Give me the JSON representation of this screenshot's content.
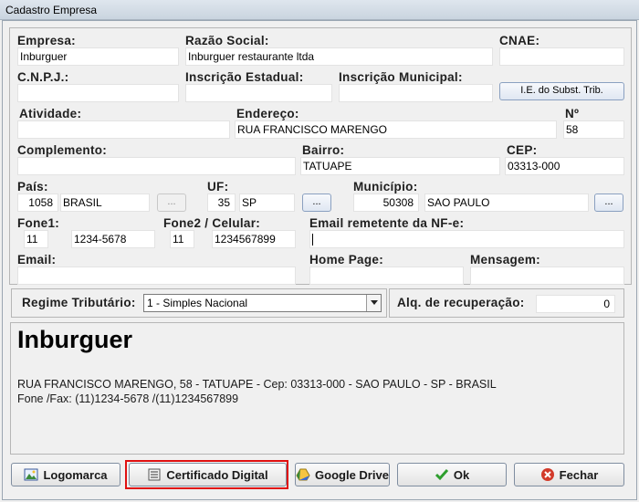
{
  "window": {
    "title": "Cadastro Empresa"
  },
  "fields": {
    "empresa": {
      "label": "Empresa:",
      "value": "Inburguer"
    },
    "razao_social": {
      "label": "Razão Social:",
      "value": "Inburguer restaurante ltda"
    },
    "cnae": {
      "label": "CNAE:",
      "value": ""
    },
    "cnpj": {
      "label": "C.N.P.J.:",
      "value": ""
    },
    "inscricao_estadual": {
      "label": "Inscrição Estadual:",
      "value": ""
    },
    "inscricao_municipal": {
      "label": "Inscrição Municipal:",
      "value": ""
    },
    "ie_subst_button": "I.E. do Subst. Trib.",
    "atividade": {
      "label": "Atividade:",
      "value": ""
    },
    "endereco": {
      "label": "Endereço:",
      "value": "RUA FRANCISCO MARENGO"
    },
    "numero": {
      "label": "Nº",
      "value": "58"
    },
    "complemento": {
      "label": "Complemento:",
      "value": ""
    },
    "bairro": {
      "label": "Bairro:",
      "value": "TATUAPE"
    },
    "cep": {
      "label": "CEP:",
      "value": "03313-000"
    },
    "pais": {
      "label": "País:",
      "code": "1058",
      "name": "BRASIL",
      "button": "..."
    },
    "uf": {
      "label": "UF:",
      "code": "35",
      "name": "SP",
      "button": "..."
    },
    "municipio": {
      "label": "Município:",
      "code": "50308",
      "name": "SAO PAULO",
      "button": "..."
    },
    "fone1": {
      "label": "Fone1:",
      "ddd": "11",
      "number": "1234-5678"
    },
    "fone2": {
      "label": "Fone2 / Celular:",
      "ddd": "11",
      "number": "1234567899"
    },
    "email_nfe": {
      "label": "Email remetente da NF-e:",
      "value": ""
    },
    "email": {
      "label": "Email:",
      "value": ""
    },
    "home_page": {
      "label": "Home Page:",
      "value": ""
    },
    "mensagem": {
      "label": "Mensagem:",
      "value": ""
    }
  },
  "regime": {
    "label": "Regime Tributário:",
    "selected": "1 - Simples Nacional"
  },
  "aliquota": {
    "label": "Alq. de recuperação:",
    "value": "0"
  },
  "preview": {
    "name": "Inburguer",
    "address_line": "RUA FRANCISCO MARENGO, 58 - TATUAPE - Cep: 03313-000 - SAO PAULO - SP - BRASIL",
    "phone_line": "Fone /Fax: (11)1234-5678 /(11)1234567899"
  },
  "buttons": {
    "logomarca": "Logomarca",
    "certificado": "Certificado Digital",
    "google_drive": "Google Drive",
    "ok": "Ok",
    "fechar": "Fechar"
  },
  "colors": {
    "highlight": "#e01010",
    "ok_green": "#2e9e2e",
    "close_red": "#d23a2a"
  }
}
